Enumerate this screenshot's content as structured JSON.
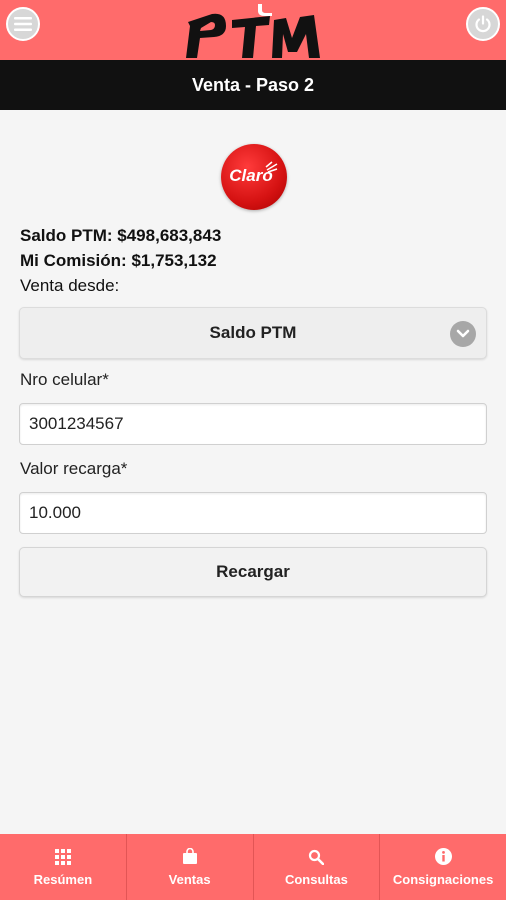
{
  "header": {
    "logo_text": "PTM",
    "menu_icon": "hamburger-icon",
    "power_icon": "power-icon",
    "accent_color": "#ff6b6b"
  },
  "titlebar": {
    "title": "Venta - Paso 2"
  },
  "operator": {
    "name": "Claro"
  },
  "balances": {
    "saldo": "Saldo PTM: $498,683,843",
    "comision": "Mi Comisión: $1,753,132"
  },
  "form": {
    "venta_desde_label": "Venta desde:",
    "venta_desde_value": "Saldo PTM",
    "celular_label": "Nro celular*",
    "celular_value": "3001234567",
    "valor_label": "Valor recarga*",
    "valor_value": "10.000",
    "submit_label": "Recargar"
  },
  "bottom_nav": {
    "items": [
      {
        "label": "Resúmen",
        "icon": "grid-icon"
      },
      {
        "label": "Ventas",
        "icon": "shopping-bag-icon"
      },
      {
        "label": "Consultas",
        "icon": "search-icon"
      },
      {
        "label": "Consignaciones",
        "icon": "info-icon"
      }
    ]
  }
}
